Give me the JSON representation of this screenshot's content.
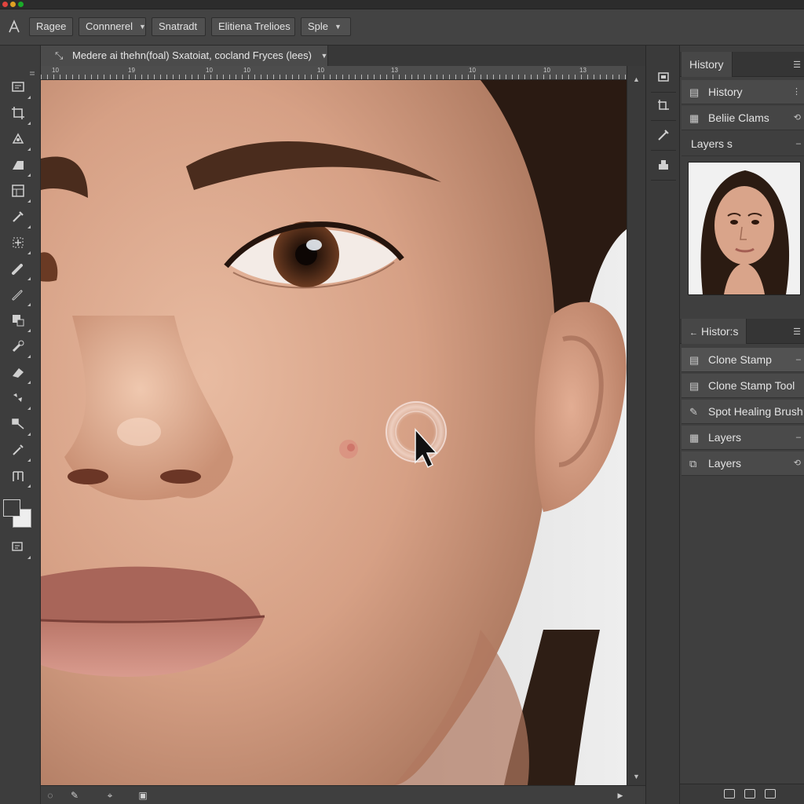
{
  "options_bar": {
    "buttons": [
      {
        "label": "Ragee",
        "dropdown": false
      },
      {
        "label": "Connnerel",
        "dropdown": true
      },
      {
        "label": "Snatradt",
        "dropdown": false
      },
      {
        "label": "Elitiena Trelioes",
        "dropdown": false
      },
      {
        "label": "Sple",
        "dropdown": true
      }
    ]
  },
  "document": {
    "tab_title": "Medere ai thehn(foal) Sxatoiat, cocland Fryces (lees)",
    "ruler_numbers": [
      "10",
      "19",
      "10",
      "10",
      "10",
      "13",
      "10",
      "10",
      "13"
    ]
  },
  "panels": {
    "top_tab": "History",
    "history_top_rows": [
      {
        "label": "History"
      },
      {
        "label": "Beliie Clams"
      }
    ],
    "layers_header": "Layers s",
    "history_tab": "Histor:s",
    "history_items": [
      {
        "label": "Clone Stamp",
        "icon": "stamp-icon"
      },
      {
        "label": "Clone Stamp Tool",
        "icon": "stamp-icon"
      },
      {
        "label": "Spot Healing Brush",
        "icon": "bandage-icon"
      },
      {
        "label": "Layers",
        "icon": "layers-icon"
      },
      {
        "label": "Layers",
        "icon": "layers-icon"
      }
    ]
  },
  "colors": {
    "ui_dark": "#3b3b3b",
    "panel": "#4a4a4a",
    "text": "#e4e4e4",
    "skin": "#d9a589"
  }
}
